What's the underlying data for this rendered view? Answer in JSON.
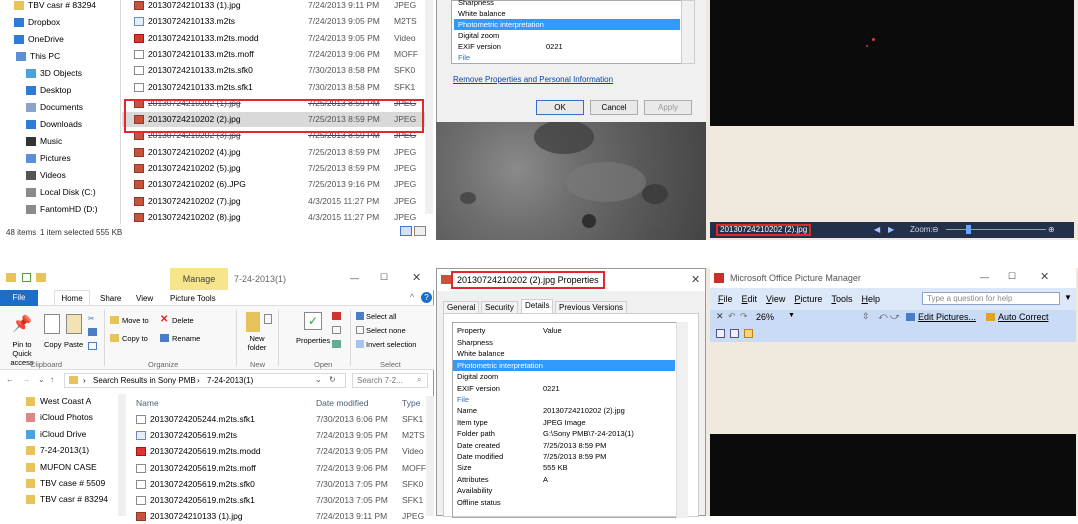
{
  "top": {
    "explorer": {
      "nav_items": [
        {
          "label": "TBV casr # 83294",
          "icon": "folder-icon"
        },
        {
          "label": "Dropbox",
          "icon": "dropbox-icon"
        },
        {
          "label": "OneDrive",
          "icon": "cloud-icon"
        },
        {
          "label": "This PC",
          "icon": "computer-icon"
        },
        {
          "label": "3D Objects",
          "icon": "cube-icon"
        },
        {
          "label": "Desktop",
          "icon": "desktop-icon"
        },
        {
          "label": "Documents",
          "icon": "documents-icon"
        },
        {
          "label": "Downloads",
          "icon": "download-icon"
        },
        {
          "label": "Music",
          "icon": "music-icon"
        },
        {
          "label": "Pictures",
          "icon": "pictures-icon"
        },
        {
          "label": "Videos",
          "icon": "videos-icon"
        },
        {
          "label": "Local Disk (C:)",
          "icon": "disk-icon"
        },
        {
          "label": "FantomHD (D:)",
          "icon": "disk-icon"
        }
      ],
      "files": [
        {
          "name": "20130724210133 (1).jpg",
          "date": "7/24/2013 9:11 PM",
          "type": "JPEG",
          "icon": "jpg",
          "style": ""
        },
        {
          "name": "20130724210133.m2ts",
          "date": "7/24/2013 9:05 PM",
          "type": "M2TS",
          "icon": "m2ts",
          "style": ""
        },
        {
          "name": "20130724210133.m2ts.modd",
          "date": "7/24/2013 9:05 PM",
          "type": "Video",
          "icon": "modd",
          "style": ""
        },
        {
          "name": "20130724210133.m2ts.moff",
          "date": "7/24/2013 9:06 PM",
          "type": "MOFF",
          "icon": "doc",
          "style": ""
        },
        {
          "name": "20130724210133.m2ts.sfk0",
          "date": "7/30/2013 8:58 PM",
          "type": "SFK0",
          "icon": "doc",
          "style": ""
        },
        {
          "name": "20130724210133.m2ts.sfk1",
          "date": "7/30/2013 8:58 PM",
          "type": "SFK1",
          "icon": "doc",
          "style": ""
        },
        {
          "name": "20130724210202 (1).jpg",
          "date": "7/25/2013 8:59 PM",
          "type": "JPEG",
          "icon": "jpg",
          "style": "strike"
        },
        {
          "name": "20130724210202 (2).jpg",
          "date": "7/25/2013 8:59 PM",
          "type": "JPEG",
          "icon": "jpg",
          "style": "selected"
        },
        {
          "name": "20130724210202 (3).jpg",
          "date": "7/25/2013 8:59 PM",
          "type": "JPEG",
          "icon": "jpg",
          "style": "strike"
        },
        {
          "name": "20130724210202 (4).jpg",
          "date": "7/25/2013 8:59 PM",
          "type": "JPEG",
          "icon": "jpg",
          "style": ""
        },
        {
          "name": "20130724210202 (5).jpg",
          "date": "7/25/2013 8:59 PM",
          "type": "JPEG",
          "icon": "jpg",
          "style": ""
        },
        {
          "name": "20130724210202 (6).JPG",
          "date": "7/25/2013 9:16 PM",
          "type": "JPEG",
          "icon": "jpg",
          "style": ""
        },
        {
          "name": "20130724210202 (7).jpg",
          "date": "4/3/2015 11:27 PM",
          "type": "JPEG",
          "icon": "jpg",
          "style": ""
        },
        {
          "name": "20130724210202 (8).jpg",
          "date": "4/3/2015 11:27 PM",
          "type": "JPEG",
          "icon": "jpg",
          "style": ""
        }
      ],
      "status": {
        "items": "48 items",
        "selected": "1 item selected",
        "size": "555 KB"
      }
    },
    "props": {
      "list": [
        "Sharpness",
        "White balance",
        "Photometric interpretation",
        "Digital zoom",
        "EXIF version",
        "File"
      ],
      "exif_value": "0221",
      "remove_link": "Remove Properties and Personal Information",
      "ok": "OK",
      "cancel": "Cancel",
      "apply": "Apply"
    },
    "viewer": {
      "filename": "20130724210202 (2).jpg",
      "zoom_label": "Zoom:"
    }
  },
  "bottom": {
    "explorer": {
      "title": "7-24-2013(1)",
      "manage_label": "Manage",
      "tabs": [
        "File",
        "Home",
        "Share",
        "View",
        "Picture Tools"
      ],
      "ribbon": {
        "pin": "Pin to Quick access",
        "copy": "Copy",
        "paste": "Paste",
        "move_to": "Move to",
        "delete": "Delete",
        "copy_to": "Copy to",
        "rename": "Rename",
        "new_folder": "New folder",
        "properties": "Properties",
        "select_all": "Select all",
        "select_none": "Select none",
        "invert_selection": "Invert selection",
        "groups": [
          "Clipboard",
          "Organize",
          "New",
          "Open",
          "Select"
        ]
      },
      "address": {
        "prefix": "Search Results in Sony PMB",
        "folder": "7-24-2013(1)"
      },
      "search_placeholder": "Search 7-2...",
      "columns": {
        "name": "Name",
        "date": "Date modified",
        "type": "Type"
      },
      "nav_items": [
        {
          "label": "West Coast A",
          "icon": "folder-icon"
        },
        {
          "label": "iCloud Photos",
          "icon": "icloud-photos-icon"
        },
        {
          "label": "iCloud Drive",
          "icon": "icloud-drive-icon"
        },
        {
          "label": "7-24-2013(1)",
          "icon": "folder-icon"
        },
        {
          "label": "MUFON CASE",
          "icon": "folder-icon"
        },
        {
          "label": "TBV case # 5509",
          "icon": "folder-icon"
        },
        {
          "label": "TBV casr # 83294",
          "icon": "folder-icon"
        }
      ],
      "files": [
        {
          "name": "20130724205244.m2ts.sfk1",
          "date": "7/30/2013 6:06 PM",
          "type": "SFK1",
          "icon": "doc"
        },
        {
          "name": "20130724205619.m2ts",
          "date": "7/24/2013 9:05 PM",
          "type": "M2TS",
          "icon": "m2ts"
        },
        {
          "name": "20130724205619.m2ts.modd",
          "date": "7/24/2013 9:05 PM",
          "type": "Video",
          "icon": "modd"
        },
        {
          "name": "20130724205619.m2ts.moff",
          "date": "7/24/2013 9:06 PM",
          "type": "MOFF",
          "icon": "doc"
        },
        {
          "name": "20130724205619.m2ts.sfk0",
          "date": "7/30/2013 7:05 PM",
          "type": "SFK0",
          "icon": "doc"
        },
        {
          "name": "20130724205619.m2ts.sfk1",
          "date": "7/30/2013 7:05 PM",
          "type": "SFK1",
          "icon": "doc"
        },
        {
          "name": "20130724210133 (1).jpg",
          "date": "7/24/2013 9:11 PM",
          "type": "JPEG",
          "icon": "jpg"
        }
      ]
    },
    "props": {
      "title": "20130724210202 (2).jpg Properties",
      "tabs": [
        "General",
        "Security",
        "Details",
        "Previous Versions"
      ],
      "col_property": "Property",
      "col_value": "Value",
      "rows": [
        {
          "p": "Sharpness",
          "v": ""
        },
        {
          "p": "White balance",
          "v": ""
        },
        {
          "p": "Photometric interpretation",
          "v": ""
        },
        {
          "p": "Digital zoom",
          "v": ""
        },
        {
          "p": "EXIF version",
          "v": "0221"
        },
        {
          "p": "File",
          "v": ""
        },
        {
          "p": "Name",
          "v": "20130724210202 (2).jpg"
        },
        {
          "p": "Item type",
          "v": "JPEG Image"
        },
        {
          "p": "Folder path",
          "v": "G:\\Sony PMB\\7-24-2013(1)"
        },
        {
          "p": "Date created",
          "v": "7/25/2013 8:59 PM"
        },
        {
          "p": "Date modified",
          "v": "7/25/2013 8:59 PM"
        },
        {
          "p": "Size",
          "v": "555 KB"
        },
        {
          "p": "Attributes",
          "v": "A"
        },
        {
          "p": "Availability",
          "v": ""
        },
        {
          "p": "Offline status",
          "v": ""
        }
      ]
    },
    "manager": {
      "title": "Microsoft Office Picture Manager",
      "menu": [
        {
          "pre": "",
          "u": "F",
          "post": "ile"
        },
        {
          "pre": "",
          "u": "E",
          "post": "dit"
        },
        {
          "pre": "",
          "u": "V",
          "post": "iew"
        },
        {
          "pre": "",
          "u": "P",
          "post": "icture"
        },
        {
          "pre": "",
          "u": "T",
          "post": "ools"
        },
        {
          "pre": "",
          "u": "H",
          "post": "elp"
        }
      ],
      "help_placeholder": "Type a question for help",
      "zoom": "26%",
      "edit_pictures": "Edit Pictures...",
      "auto_correct": "Auto Correct"
    }
  },
  "colors": {
    "highlight": "#3399ff",
    "red_box": "#e0282e",
    "dark": "#0b0b0b",
    "beige": "#efe9de"
  }
}
